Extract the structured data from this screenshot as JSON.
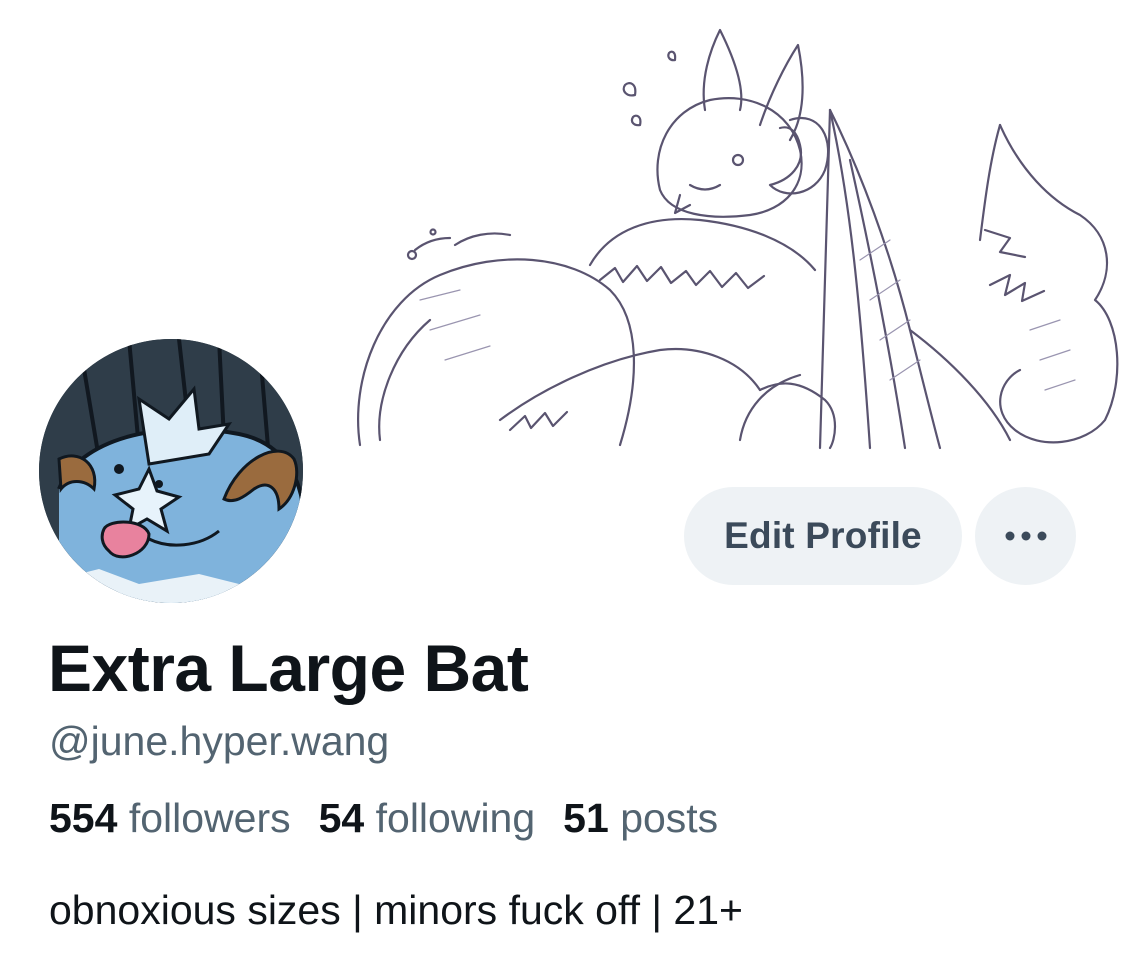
{
  "profile": {
    "display_name": "Extra Large Bat",
    "handle": "@june.hyper.wang",
    "bio": "obnoxious sizes | minors fuck off | 21+"
  },
  "stats": {
    "followers_count": "554",
    "followers_label": "followers",
    "following_count": "54",
    "following_label": "following",
    "posts_count": "51",
    "posts_label": "posts"
  },
  "actions": {
    "edit_label": "Edit Profile",
    "more_icon": "more-horizontal-icon"
  },
  "colors": {
    "primary_text": "#0f1419",
    "secondary_text": "#536471",
    "button_bg": "#eef2f5",
    "button_text": "#3b4a5a"
  }
}
